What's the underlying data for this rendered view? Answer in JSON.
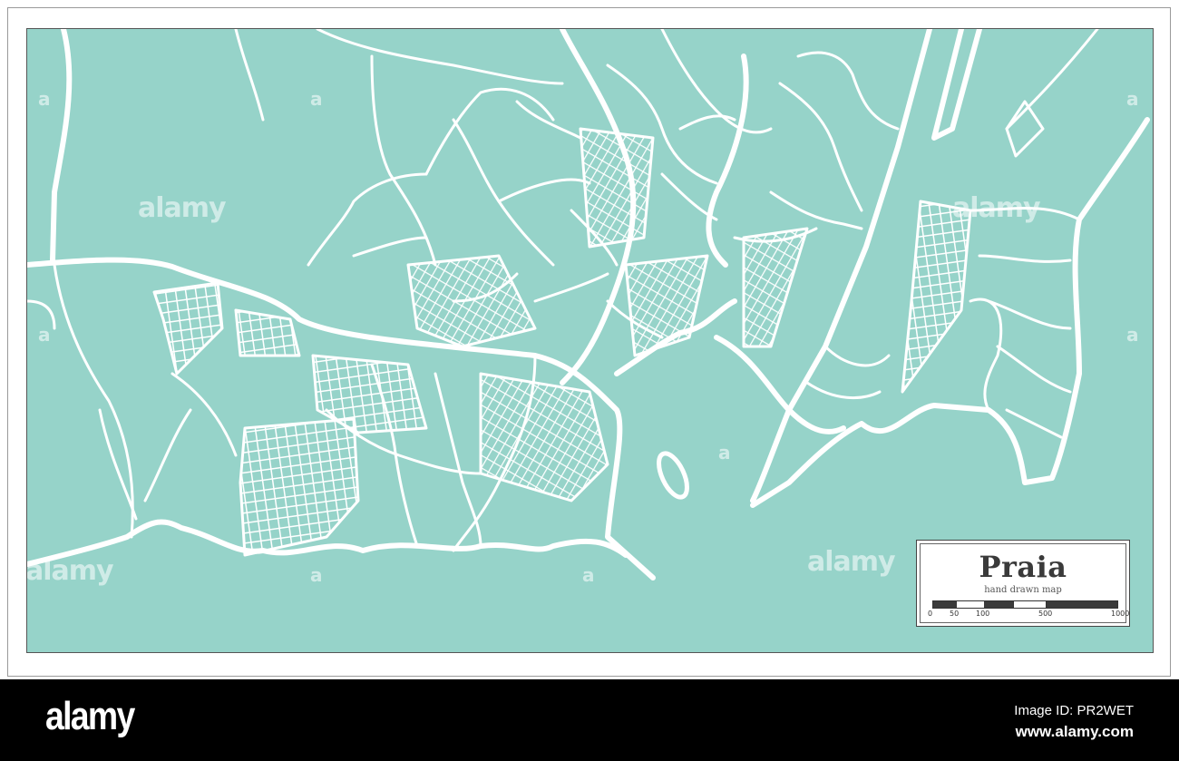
{
  "map": {
    "city": "Praia",
    "subtitle": "hand drawn map",
    "background_color": "#96d3c9",
    "road_color": "#ffffff",
    "scale": {
      "ticks": [
        "0",
        "50",
        "100",
        "500",
        "1000"
      ],
      "segment_colors": [
        "#3a3a3a",
        "#ffffff",
        "#3a3a3a",
        "#ffffff",
        "#3a3a3a"
      ]
    }
  },
  "watermark": {
    "text": "alamy",
    "letter": "a"
  },
  "footer": {
    "logo": "alamy",
    "image_id": "Image ID: PR2WET",
    "url": "www.alamy.com"
  }
}
